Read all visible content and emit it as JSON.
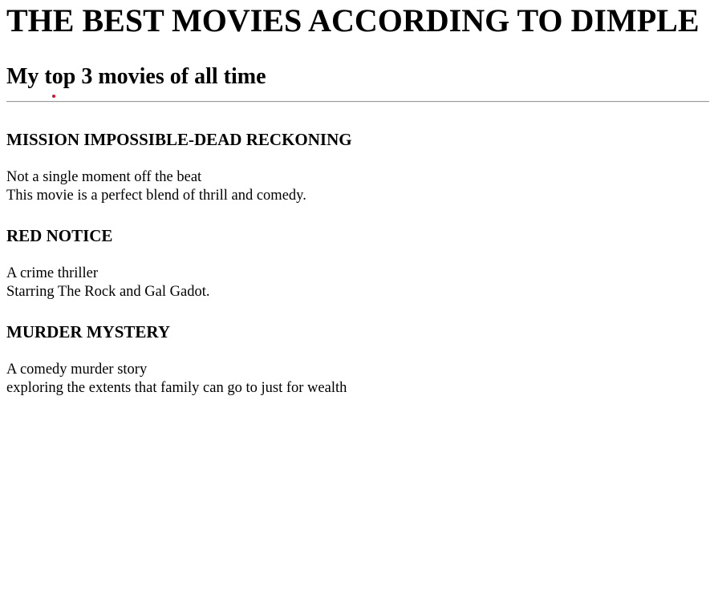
{
  "page": {
    "title": "THE BEST MOVIES ACCORDING TO DIMPLE",
    "subtitle": "My top 3 movies of all time"
  },
  "movies": [
    {
      "title": "MISSION IMPOSSIBLE-DEAD RECKONING",
      "line1": "Not a single moment off the beat",
      "line2": "This movie is a perfect blend of thrill and comedy."
    },
    {
      "title": "RED NOTICE",
      "line1": "A crime thriller",
      "line2": "Starring The Rock and Gal Gadot."
    },
    {
      "title": "MURDER MYSTERY",
      "line1": "A comedy murder story",
      "line2": "exploring the extents that family can go to just for wealth"
    }
  ]
}
